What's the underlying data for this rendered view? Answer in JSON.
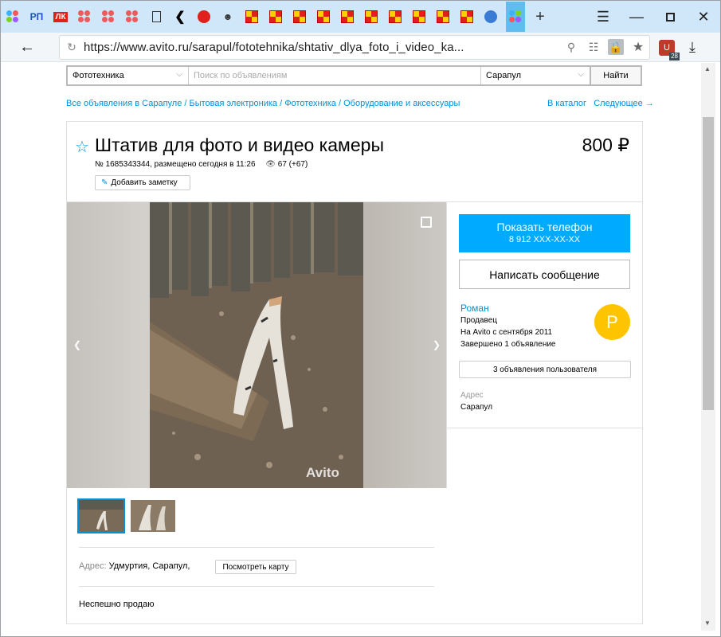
{
  "browser": {
    "tabs": [
      {
        "icon": "multicolor-dots-icon"
      },
      {
        "icon": "rp-logo-icon",
        "label": "РП"
      },
      {
        "icon": "lk-logo-icon",
        "label": "ЛК"
      },
      {
        "icon": "yandex-dots-icon"
      },
      {
        "icon": "yandex-dots-icon"
      },
      {
        "icon": "yandex-dots-icon"
      },
      {
        "icon": "document-icon"
      },
      {
        "icon": "back-arrow-icon"
      }
    ],
    "new_tab": "+",
    "url": "https://www.avito.ru/sarapul/fototehnika/shtativ_dlya_foto_i_video_ka...",
    "extension_badge": "28"
  },
  "search": {
    "category": "Фототехника",
    "query_placeholder": "Поиск по объявлениям",
    "city": "Сарапул",
    "button": "Найти"
  },
  "breadcrumbs": [
    "Все объявления в Сарапуле",
    "Бытовая электроника",
    "Фототехника",
    "Оборудование и аксессуары"
  ],
  "catalog_link": "В каталог",
  "next_link": "Следующее →",
  "item": {
    "title": "Штатив для фото и видео камеры",
    "price": "800 ₽",
    "meta": "№ 1685343344, размещено сегодня в 11:26",
    "views": "67 (+67)",
    "note_button": "Добавить заметку",
    "watermark": "Avito",
    "address_label": "Адрес:",
    "address": "Удмуртия, Сарапул,",
    "map_button": "Посмотреть карту",
    "description": "Неспешно продаю"
  },
  "seller": {
    "phone_button": "Показать телефон",
    "phone_masked": "8 912 XXX-XX-XX",
    "message_button": "Написать сообщение",
    "name": "Роман",
    "role": "Продавец",
    "since": "На Avito с сентября 2011",
    "completed": "Завершено 1 объявление",
    "avatar_letter": "Р",
    "ads_button": "3 объявления пользователя",
    "address_label": "Адрес",
    "address": "Сарапул"
  },
  "colors": {
    "accent": "#0091d9",
    "phone_button": "#00aaff",
    "avatar": "#ffc400",
    "tabbar": "#cfe7f9"
  }
}
